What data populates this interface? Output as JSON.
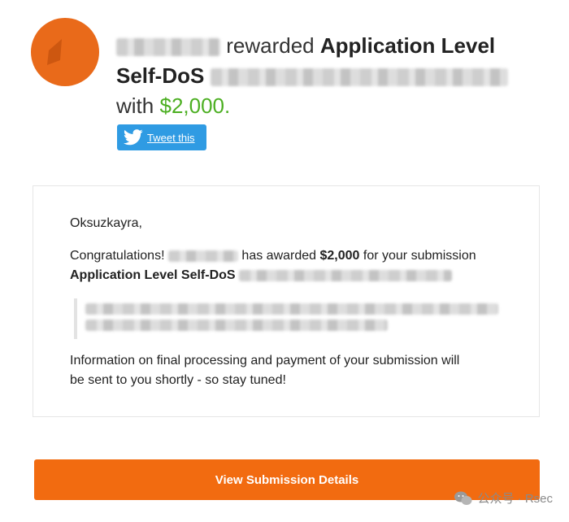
{
  "header": {
    "rewarded_word": "rewarded",
    "report_title": "Application Level Self-DoS",
    "with_word": "with",
    "amount": "$2,000."
  },
  "tweet": {
    "label": "Tweet this",
    "icon": "twitter-bird-icon"
  },
  "email": {
    "greeting": "Oksuzkayra,",
    "congrats_prefix": "Congratulations!",
    "congrats_middle": "has awarded",
    "congrats_amount": "$2,000",
    "congrats_suffix": "for your submission",
    "submission_title": "Application Level Self-DoS",
    "info_line1": "Information on final processing and payment of your submission will",
    "info_line2": "be sent to you shortly - so stay tuned!"
  },
  "cta": {
    "label": "View Submission Details"
  },
  "watermark": {
    "text": "公众号 · Rsec"
  },
  "colors": {
    "brand_orange": "#f26b10",
    "avatar_orange": "#e96a1a",
    "amount_green": "#4caf22",
    "twitter_blue": "#2f9be3"
  }
}
